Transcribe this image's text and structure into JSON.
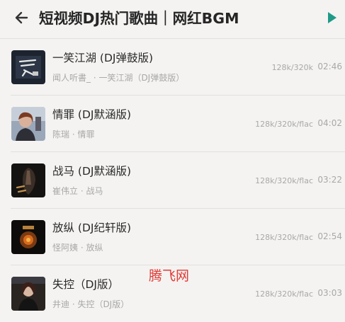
{
  "header": {
    "title": "短视频DJ热门歌曲｜网红BGM",
    "back_icon": "back-arrow-icon",
    "play_icon": "play-icon",
    "accent_color": "#1f9a88"
  },
  "songs": [
    {
      "title": "一笑江湖 (DJ弹鼓版)",
      "subtitle": "闻人听書_ · 一笑江湖（DJ弹鼓版）",
      "quality": "128k/320k",
      "duration": "02:46"
    },
    {
      "title": "情罪 (DJ默涵版)",
      "subtitle": "陈瑞 · 情罪",
      "quality": "128k/320k/flac",
      "duration": "04:02"
    },
    {
      "title": "战马 (DJ默涵版)",
      "subtitle": "崔伟立 · 战马",
      "quality": "128k/320k/flac",
      "duration": "03:22"
    },
    {
      "title": "放纵 (DJ纪轩版)",
      "subtitle": "怪阿姨 · 放纵",
      "quality": "128k/320k/flac",
      "duration": "02:54"
    },
    {
      "title": "失控（DJ版）",
      "subtitle": "井迪 · 失控（DJ版）",
      "quality": "128k/320k/flac",
      "duration": "03:03"
    }
  ],
  "watermark": {
    "text": "腾飞网"
  }
}
